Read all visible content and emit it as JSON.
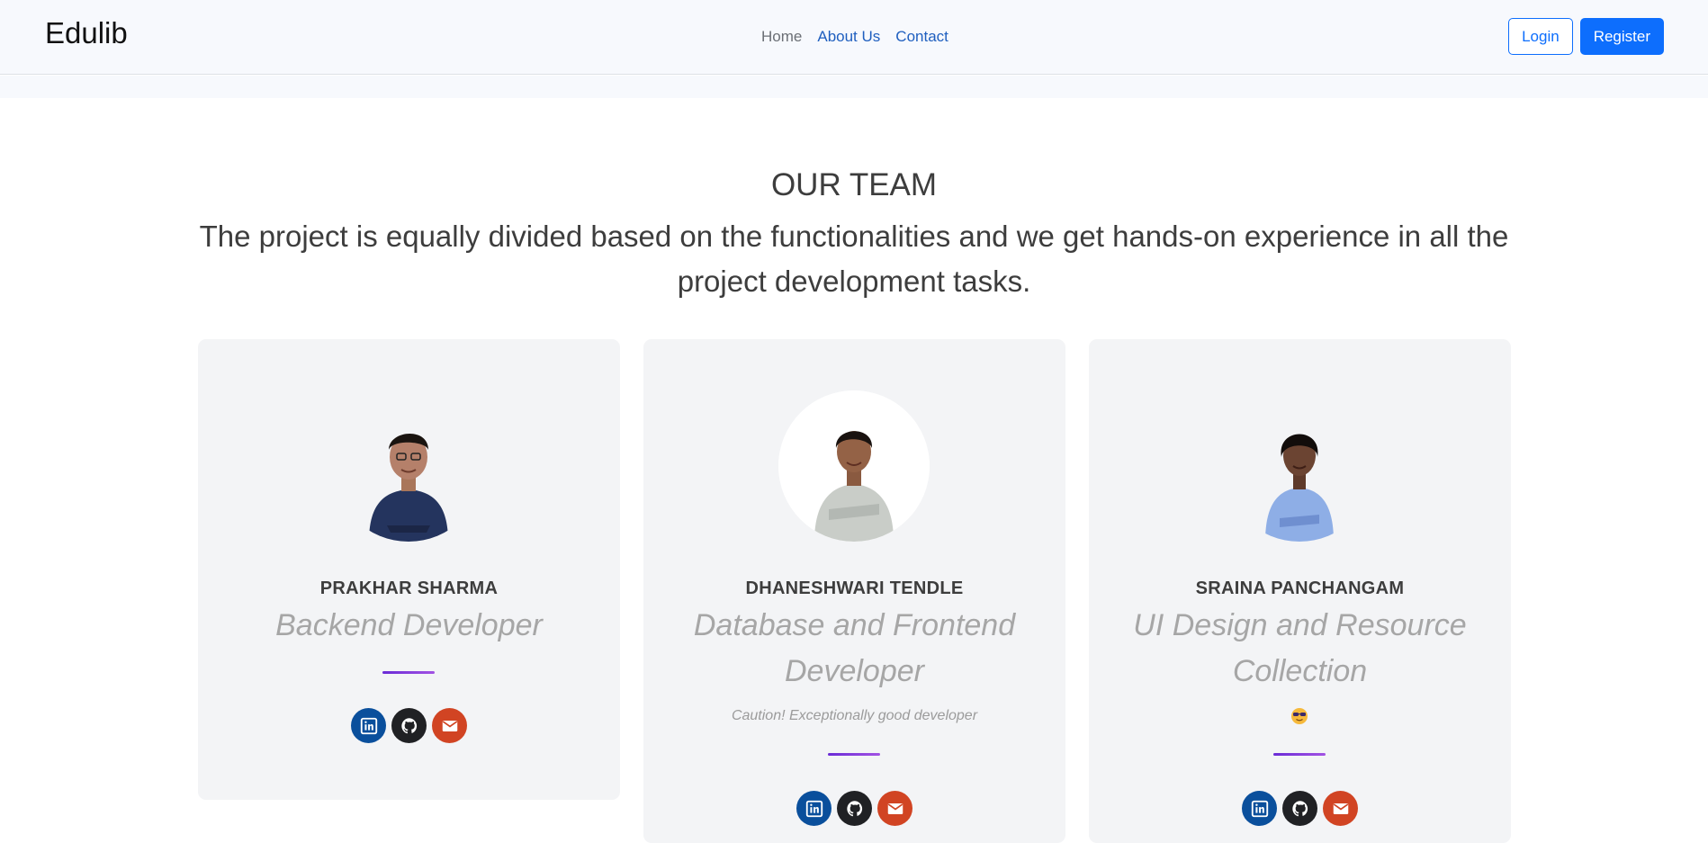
{
  "navbar": {
    "brand": "Edulib",
    "links": [
      {
        "label": "Home"
      },
      {
        "label": "About Us"
      },
      {
        "label": "Contact"
      }
    ],
    "login_label": "Login",
    "register_label": "Register"
  },
  "team": {
    "title": "OUR TEAM",
    "subtitle": "The project is equally divided based on the functionalities and we get hands-on experience in all the project development tasks.",
    "members": [
      {
        "name": "PRAKHAR SHARMA",
        "role": "Backend Developer",
        "socials": [
          "linkedin-icon",
          "github-icon",
          "mail-icon"
        ]
      },
      {
        "name": "DHANESHWARI TENDLE",
        "role": "Database and Frontend Developer",
        "note": "Caution! Exceptionally good developer",
        "socials": [
          "linkedin-icon",
          "github-icon",
          "mail-icon"
        ]
      },
      {
        "name": "SRAINA PANCHANGAM",
        "role": "UI Design and Resource Collection",
        "note_icon": "sunglasses-emoji-icon",
        "socials": [
          "linkedin-icon",
          "github-icon",
          "mail-icon"
        ]
      }
    ]
  },
  "colors": {
    "primary": "#0d6efd",
    "linkedin": "#0a4f9c",
    "github": "#202124",
    "mail": "#d14423",
    "divider": "#7b35da"
  }
}
